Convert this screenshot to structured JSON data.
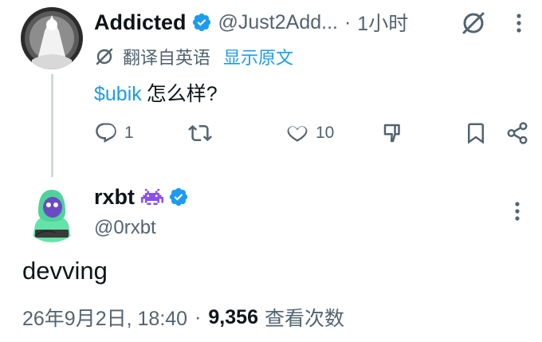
{
  "parent_tweet": {
    "display_name": "Addicted",
    "handle": "@Just2Add...",
    "separator": "·",
    "time": "1小时",
    "translate_label": "翻译自英语",
    "show_original_label": "显示原文",
    "cashtag": "$ubik",
    "text": "怎么样?",
    "actions": {
      "reply_count": "1",
      "retweet_count": "",
      "like_count": "10"
    },
    "icons": {
      "grok": "grok-icon",
      "more": "more-horizontal-icon",
      "verified": "verified-badge-icon",
      "translate": "translate-icon",
      "reply": "reply-icon",
      "retweet": "retweet-icon",
      "like": "heart-icon",
      "dislike": "thumbs-down-icon",
      "bookmark": "bookmark-icon",
      "share": "share-icon"
    }
  },
  "reply_tweet": {
    "display_name": "rxbt",
    "emoji": "alien-monster-emoji",
    "handle": "@0rxbt",
    "text": "devving",
    "timestamp": "26年9月2日, 18:40",
    "separator": "·",
    "views_count": "9,356",
    "views_label": "查看次数"
  },
  "colors": {
    "accent": "#1d9bf0",
    "text_primary": "#0f1419",
    "text_secondary": "#536471",
    "thread_line": "#cfd9de",
    "emoji_purple": "#8a4ff0"
  }
}
